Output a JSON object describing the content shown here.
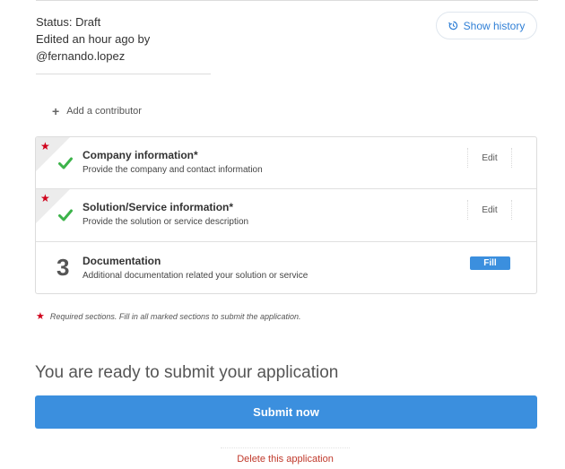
{
  "status": {
    "label": "Status: Draft",
    "edited": "Edited an hour ago by",
    "user": "@fernando.lopez"
  },
  "history_button": {
    "label": "Show history",
    "icon": "history-icon"
  },
  "contributor": {
    "label": "Add a contributor",
    "icon": "plus-icon"
  },
  "sections": [
    {
      "title": "Company information*",
      "description": "Provide the company and contact information",
      "action": "Edit",
      "required": true,
      "completed": true
    },
    {
      "title": "Solution/Service information*",
      "description": "Provide the solution or service description",
      "action": "Edit",
      "required": true,
      "completed": true
    },
    {
      "number": "3",
      "title": "Documentation",
      "description": "Additional documentation related your solution or service",
      "action": "Fill",
      "required": false,
      "completed": false
    }
  ],
  "required_note": "Required sections. Fill in all marked sections to submit the application.",
  "ready_title": "You are ready to submit your application",
  "submit_label": "Submit now",
  "delete_label": "Delete this application",
  "colors": {
    "accent": "#3b8fde",
    "required": "#d0021b",
    "check": "#3cb34a",
    "danger": "#c0392b"
  }
}
